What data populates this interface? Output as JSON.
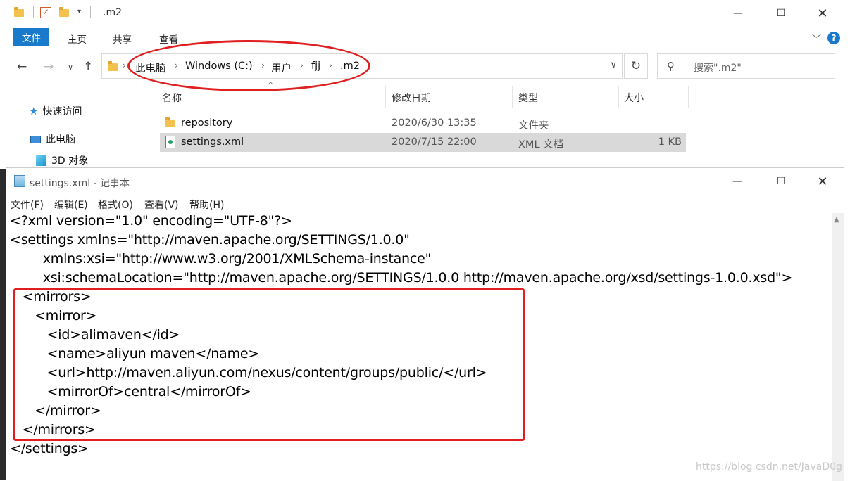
{
  "explorer": {
    "title": ".m2",
    "ribbon_tabs": [
      "文件",
      "主页",
      "共享",
      "查看"
    ],
    "breadcrumb": [
      "此电脑",
      "Windows (C:)",
      "用户",
      "fjj",
      ".m2"
    ],
    "search_placeholder": "搜索\".m2\"",
    "sidebar": [
      {
        "label": "快速访问",
        "icon": "star-icon"
      },
      {
        "label": "此电脑",
        "icon": "computer-icon"
      },
      {
        "label": "3D 对象",
        "icon": "cube-icon"
      }
    ],
    "columns": [
      "名称",
      "修改日期",
      "类型",
      "大小"
    ],
    "files": [
      {
        "name": "repository",
        "modified": "2020/6/30 13:35",
        "type": "文件夹",
        "size": "",
        "icon": "folder-icon",
        "selected": false
      },
      {
        "name": "settings.xml",
        "modified": "2020/7/15 22:00",
        "type": "XML 文档",
        "size": "1 KB",
        "icon": "xml-file-icon",
        "selected": true
      }
    ]
  },
  "notepad": {
    "title": "settings.xml - 记事本",
    "menu": [
      "文件(F)",
      "编辑(E)",
      "格式(O)",
      "查看(V)",
      "帮助(H)"
    ],
    "lines": [
      "<?xml version=\"1.0\" encoding=\"UTF-8\"?>",
      "<settings xmlns=\"http://maven.apache.org/SETTINGS/1.0.0\"",
      "        xmlns:xsi=\"http://www.w3.org/2001/XMLSchema-instance\"",
      "        xsi:schemaLocation=\"http://maven.apache.org/SETTINGS/1.0.0 http://maven.apache.org/xsd/settings-1.0.0.xsd\">",
      "   <mirrors>",
      "      <mirror>",
      "         <id>alimaven</id>",
      "         <name>aliyun maven</name>",
      "         <url>http://maven.aliyun.com/nexus/content/groups/public/</url>",
      "         <mirrorOf>central</mirrorOf>",
      "      </mirror>",
      "   </mirrors>",
      "</settings>"
    ],
    "watermark": "https://blog.csdn.net/JavaD0g"
  },
  "colors": {
    "accent": "#1979ca",
    "annotation_red": "#e02020",
    "selection": "#d9d9d9"
  }
}
